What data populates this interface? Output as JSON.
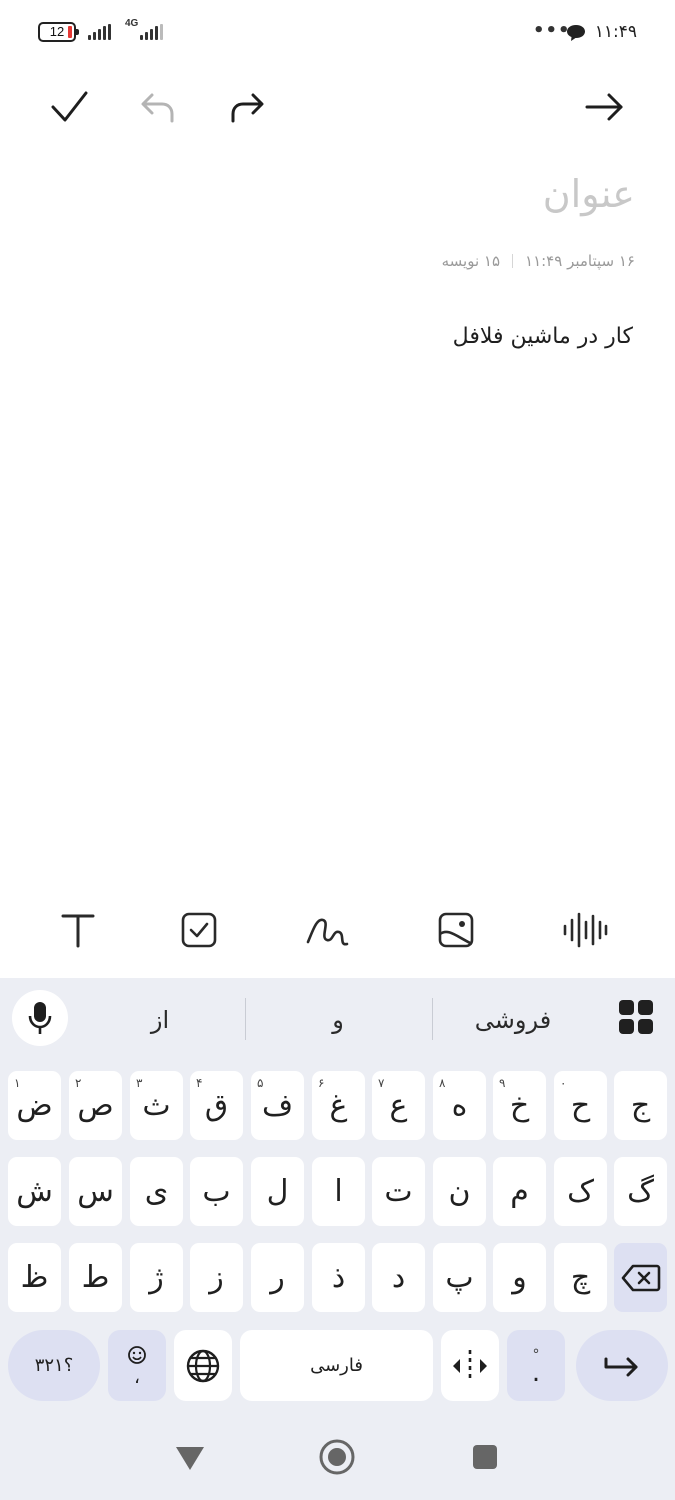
{
  "status_bar": {
    "battery_level": "12",
    "network_label": "4G",
    "time": "۱۱:۴۹",
    "more_dots": "•••"
  },
  "toolbar": {
    "confirm_icon": "check-icon",
    "undo_icon": "undo-icon",
    "redo_icon": "redo-icon",
    "back_icon": "arrow-right-icon"
  },
  "note": {
    "title_placeholder": "عنوان",
    "date": "۱۶ سپتامبر ۱۱:۴۹",
    "char_count": "۱۵ نویسه",
    "body": "کار در ماشین فلافل"
  },
  "format_bar": {
    "icons": [
      "text-format-icon",
      "checkbox-icon",
      "handwriting-icon",
      "image-icon",
      "voice-waveform-icon"
    ]
  },
  "keyboard": {
    "suggestions": [
      "از",
      "و",
      "فروشی"
    ],
    "row1": [
      {
        "char": "ض",
        "sup": "۱"
      },
      {
        "char": "ص",
        "sup": "۲"
      },
      {
        "char": "ث",
        "sup": "۳"
      },
      {
        "char": "ق",
        "sup": "۴"
      },
      {
        "char": "ف",
        "sup": "۵"
      },
      {
        "char": "غ",
        "sup": "۶"
      },
      {
        "char": "ع",
        "sup": "۷"
      },
      {
        "char": "ه",
        "sup": "۸"
      },
      {
        "char": "خ",
        "sup": "۹"
      },
      {
        "char": "ح",
        "sup": "۰"
      },
      {
        "char": "ج",
        "sup": ""
      }
    ],
    "row2": [
      "ش",
      "س",
      "ی",
      "ب",
      "ل",
      "ا",
      "ت",
      "ن",
      "م",
      "ک",
      "گ"
    ],
    "row3": [
      "ظ",
      "ط",
      "ژ",
      "ز",
      "ر",
      "ذ",
      "د",
      "پ",
      "و",
      "چ"
    ],
    "numbers_key": "؟۳۲۱",
    "comma_key": "،",
    "space_label": "فارسی",
    "period_key": ".",
    "accent_color": "#dde0f2"
  },
  "nav_bar": {
    "back_icon": "back-triangle-icon",
    "home_icon": "home-circle-icon",
    "recents_icon": "recents-square-icon"
  }
}
